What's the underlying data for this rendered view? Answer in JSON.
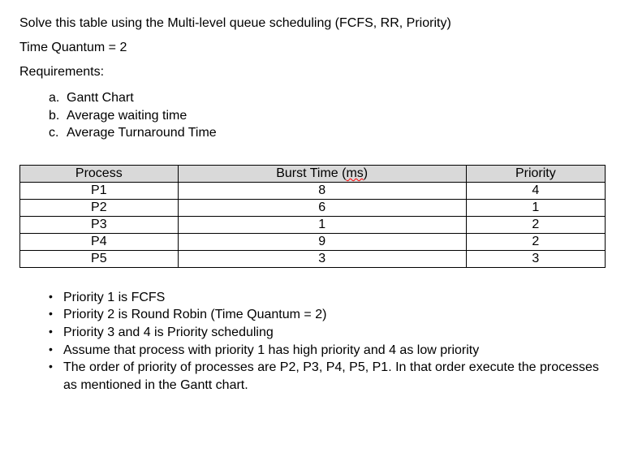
{
  "title": "Solve this table using the Multi-level queue scheduling (FCFS, RR, Priority)",
  "quantum_line": "Time Quantum = 2",
  "requirements_label": "Requirements:",
  "req_items": [
    {
      "marker": "a.",
      "text": "Gantt Chart"
    },
    {
      "marker": "b.",
      "text": "Average waiting time"
    },
    {
      "marker": "c.",
      "text": "Average Turnaround Time"
    }
  ],
  "table": {
    "headers": {
      "process": "Process",
      "burst_prefix": "Burst Time (",
      "burst_unit": "ms",
      "burst_suffix": ")",
      "priority": "Priority"
    },
    "rows": [
      {
        "process": "P1",
        "burst": "8",
        "priority": "4"
      },
      {
        "process": "P2",
        "burst": "6",
        "priority": "1"
      },
      {
        "process": "P3",
        "burst": "1",
        "priority": "2"
      },
      {
        "process": "P4",
        "burst": "9",
        "priority": "2"
      },
      {
        "process": "P5",
        "burst": "3",
        "priority": "3"
      }
    ]
  },
  "notes": [
    "Priority 1 is FCFS",
    "Priority 2 is Round Robin (Time Quantum = 2)",
    "Priority 3 and 4 is Priority scheduling",
    "Assume that process with priority 1 has high priority and 4 as low priority",
    "The order of priority of processes are P2, P3, P4, P5, P1. In that order execute the processes as mentioned in the Gantt chart."
  ]
}
